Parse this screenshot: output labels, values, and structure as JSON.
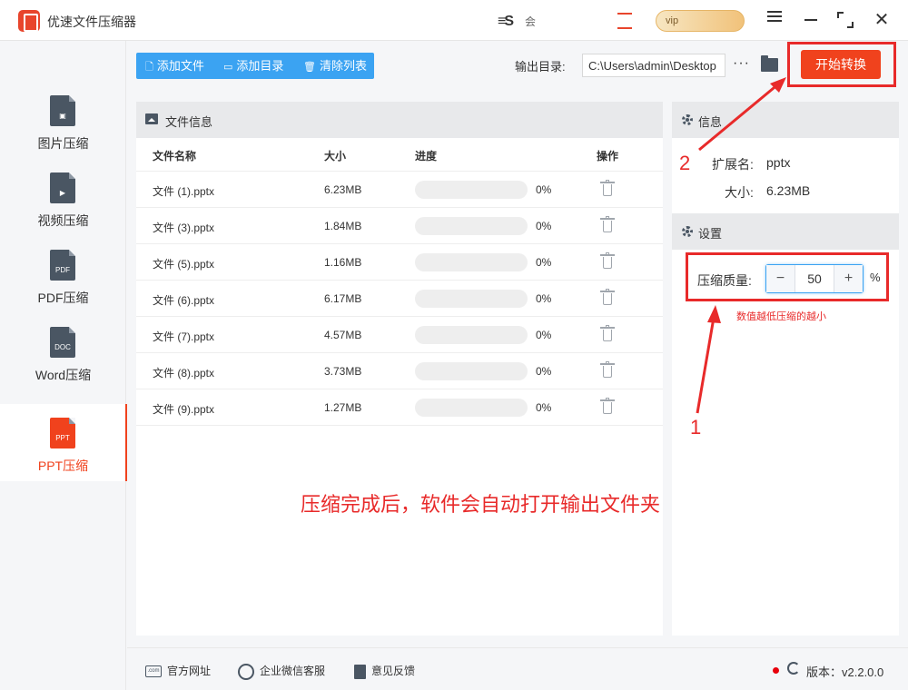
{
  "app": {
    "title": "优速文件压缩器",
    "titlebar_mid_text": "会",
    "vip_pill_text": "vip"
  },
  "sidebar": {
    "items": [
      {
        "label": "图片压缩",
        "icon": "image-file-icon",
        "badge": ""
      },
      {
        "label": "视频压缩",
        "icon": "video-file-icon",
        "badge": "▶"
      },
      {
        "label": "PDF压缩",
        "icon": "pdf-file-icon",
        "badge": "PDF"
      },
      {
        "label": "Word压缩",
        "icon": "word-file-icon",
        "badge": "DOC"
      },
      {
        "label": "PPT压缩",
        "icon": "ppt-file-icon",
        "badge": "PPT",
        "active": true
      }
    ]
  },
  "toolbar": {
    "add_file": "添加文件",
    "add_dir": "添加目录",
    "clear_list": "清除列表",
    "output_label": "输出目录:",
    "output_path": "C:\\Users\\admin\\Desktop",
    "more": "···",
    "start": "开始转换"
  },
  "file_panel": {
    "title": "文件信息",
    "columns": {
      "name": "文件名称",
      "size": "大小",
      "progress": "进度",
      "action": "操作"
    },
    "rows": [
      {
        "name": "文件 (1).pptx",
        "size": "6.23MB",
        "progress": 0,
        "progress_text": "0%"
      },
      {
        "name": "文件 (3).pptx",
        "size": "1.84MB",
        "progress": 0,
        "progress_text": "0%"
      },
      {
        "name": "文件 (5).pptx",
        "size": "1.16MB",
        "progress": 0,
        "progress_text": "0%"
      },
      {
        "name": "文件 (6).pptx",
        "size": "6.17MB",
        "progress": 0,
        "progress_text": "0%"
      },
      {
        "name": "文件 (7).pptx",
        "size": "4.57MB",
        "progress": 0,
        "progress_text": "0%"
      },
      {
        "name": "文件 (8).pptx",
        "size": "3.73MB",
        "progress": 0,
        "progress_text": "0%"
      },
      {
        "name": "文件 (9).pptx",
        "size": "1.27MB",
        "progress": 0,
        "progress_text": "0%"
      }
    ]
  },
  "info_panel": {
    "title": "信息",
    "ext_label": "扩展名:",
    "ext_value": "pptx",
    "size_label": "大小:",
    "size_value": "6.23MB"
  },
  "settings_panel": {
    "title": "设置",
    "quality_label": "压缩质量:",
    "quality_value": "50",
    "minus": "−",
    "plus": "+",
    "percent": "%",
    "hint": "数值越低压缩的越小"
  },
  "annotations": {
    "step1": "1",
    "step2": "2",
    "note": "压缩完成后，软件会自动打开输出文件夹",
    "color": "#e82a2a"
  },
  "footer": {
    "website": "官方网址",
    "wechat": "企业微信客服",
    "feedback": "意见反馈",
    "com_badge": ".com",
    "version": "版本：v2.2.0.0"
  },
  "colors": {
    "accent_orange": "#f0421d",
    "toolbar_blue": "#3ba3f2",
    "icon_dark": "#4a5663"
  }
}
